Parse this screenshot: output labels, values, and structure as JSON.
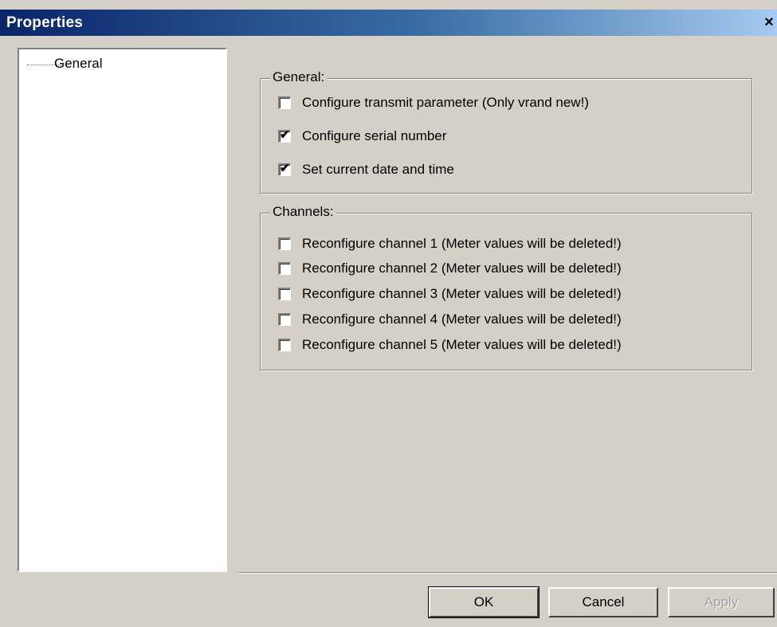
{
  "window": {
    "title": "Properties",
    "close_glyph": "×"
  },
  "tree": {
    "items": [
      {
        "label": "General"
      }
    ]
  },
  "general_group": {
    "title": "General:",
    "options": [
      {
        "label": "Configure transmit parameter (Only vrand new!)",
        "checked": false
      },
      {
        "label": "Configure serial number",
        "checked": true
      },
      {
        "label": "Set current date and time",
        "checked": true
      }
    ]
  },
  "channels_group": {
    "title": "Channels:",
    "options": [
      {
        "label": "Reconfigure channel 1 (Meter values will be deleted!)",
        "checked": false
      },
      {
        "label": "Reconfigure channel 2 (Meter values will be deleted!)",
        "checked": false
      },
      {
        "label": "Reconfigure channel 3 (Meter values will be deleted!)",
        "checked": false
      },
      {
        "label": "Reconfigure channel 4 (Meter values will be deleted!)",
        "checked": false
      },
      {
        "label": "Reconfigure channel 5 (Meter values will be deleted!)",
        "checked": false
      }
    ]
  },
  "buttons": {
    "ok": "OK",
    "cancel": "Cancel",
    "apply": "Apply"
  },
  "icons": {
    "check": "check-icon",
    "close": "close-icon"
  }
}
